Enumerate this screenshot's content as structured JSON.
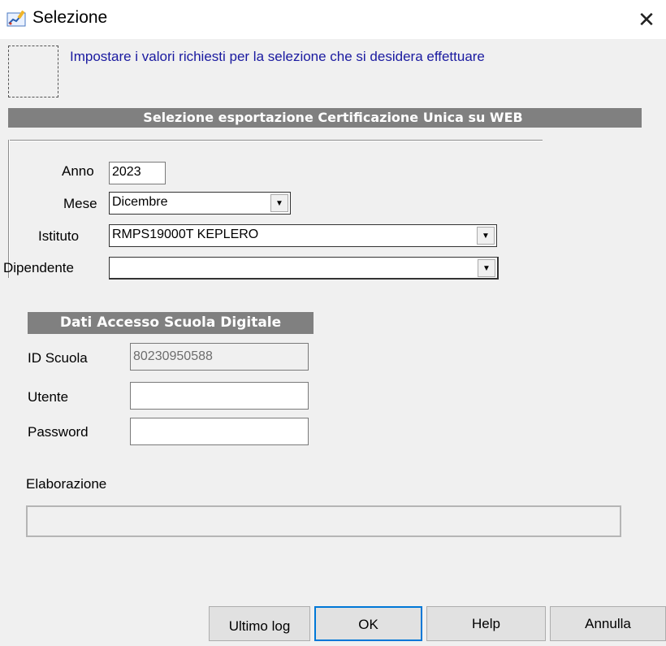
{
  "window": {
    "title": "Selezione",
    "close_icon": "close-icon",
    "app_icon": "chart-edit-icon"
  },
  "hint": {
    "text": "Impostare i valori richiesti per la selezione che si desidera effettuare"
  },
  "section": {
    "header": "Selezione esportazione Certificazione Unica su WEB",
    "anno": {
      "label": "Anno",
      "value": "2023"
    },
    "mese": {
      "label": "Mese",
      "value": "Dicembre"
    },
    "istituto": {
      "label": "Istituto",
      "value": "RMPS19000T KEPLERO"
    },
    "dipendente": {
      "label": "Dipendente",
      "value": ""
    }
  },
  "scuola_digitale": {
    "header": "Dati Accesso Scuola Digitale",
    "id_label": "ID Scuola",
    "id_value": "80230950588",
    "utente_label": "Utente",
    "utente_value": "",
    "password_label": "Password",
    "password_value": ""
  },
  "elaborazione": {
    "label": "Elaborazione",
    "progress": 0
  },
  "buttons": {
    "log": "Ultimo log",
    "ok": "OK",
    "help": "Help",
    "cancel": "Annulla"
  },
  "colors": {
    "hint_text": "#1a1aa0",
    "header_bg": "#808080",
    "focus_border": "#0078d7"
  }
}
